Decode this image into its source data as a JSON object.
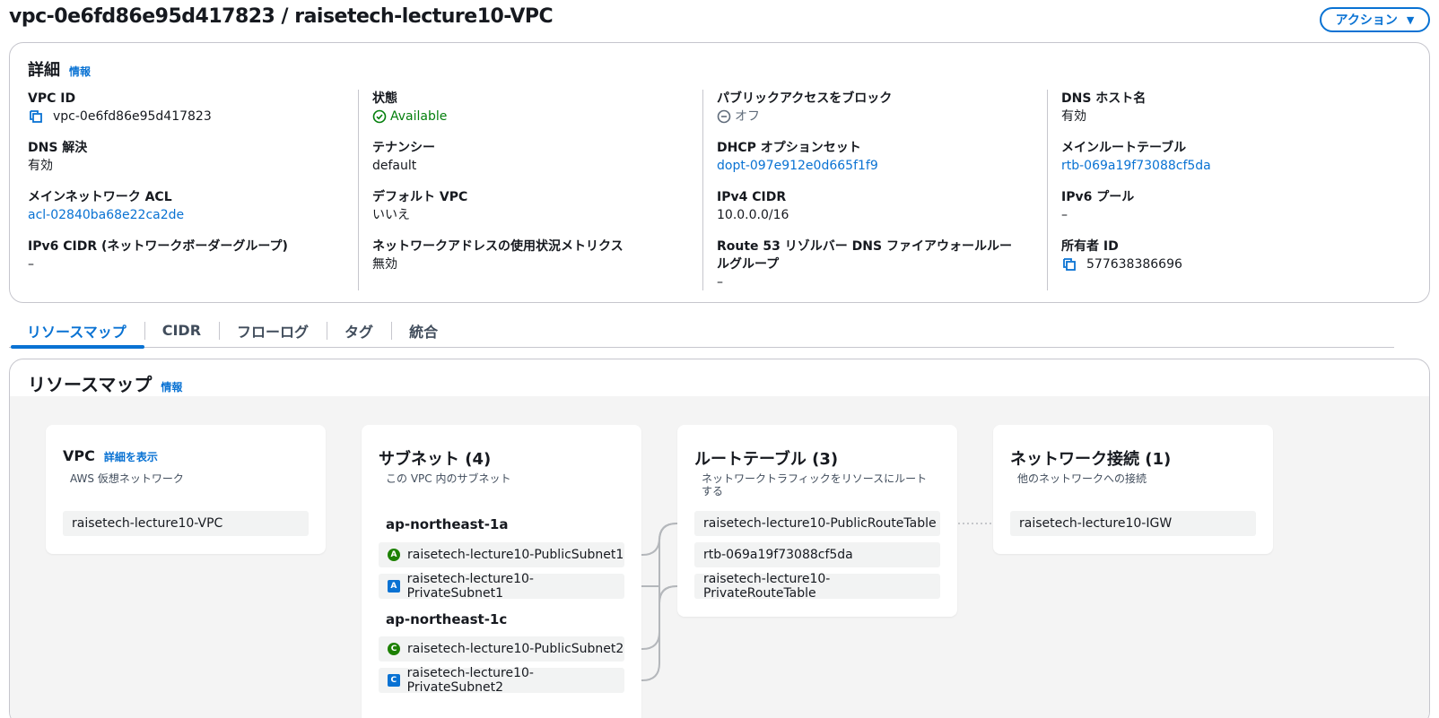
{
  "header": {
    "title": "vpc-0e6fd86e95d417823 / raisetech-lecture10-VPC",
    "actions_label": "アクション",
    "actions_caret": "▼"
  },
  "details": {
    "title": "詳細",
    "info_link": "情報",
    "columns": [
      {
        "fields": [
          {
            "label": "VPC ID",
            "value": "vpc-0e6fd86e95d417823"
          },
          {
            "label": "DNS 解決",
            "value": "有効"
          },
          {
            "label": "メインネットワーク ACL",
            "value": "acl-02840ba68e22ca2de"
          },
          {
            "label": "IPv6 CIDR (ネットワークボーダーグループ)",
            "value": "–"
          }
        ]
      },
      {
        "fields": [
          {
            "label": "状態",
            "value": "Available"
          },
          {
            "label": "テナンシー",
            "value": "default"
          },
          {
            "label": "デフォルト VPC",
            "value": "いいえ"
          },
          {
            "label": "ネットワークアドレスの使用状況メトリクス",
            "value": "無効"
          }
        ]
      },
      {
        "fields": [
          {
            "label": "パブリックアクセスをブロック",
            "value": "オフ"
          },
          {
            "label": "DHCP オプションセット",
            "value": "dopt-097e912e0d665f1f9"
          },
          {
            "label": "IPv4 CIDR",
            "value": "10.0.0.0/16"
          },
          {
            "label": "Route 53 リゾルバー DNS ファイアウォールルールグループ",
            "value": "–"
          }
        ]
      },
      {
        "fields": [
          {
            "label": "DNS ホスト名",
            "value": "有効"
          },
          {
            "label": "メインルートテーブル",
            "value": "rtb-069a19f73088cf5da"
          },
          {
            "label": "IPv6 プール",
            "value": "–"
          },
          {
            "label": "所有者 ID",
            "value": "577638386696"
          }
        ]
      }
    ]
  },
  "tabs": [
    {
      "label": "リソースマップ",
      "active": true
    },
    {
      "label": "CIDR",
      "active": false
    },
    {
      "label": "フローログ",
      "active": false
    },
    {
      "label": "タグ",
      "active": false
    },
    {
      "label": "統合",
      "active": false
    }
  ],
  "resource_map": {
    "title": "リソースマップ",
    "info_link": "情報",
    "vpc": {
      "title": "VPC",
      "detail_link": "詳細を表示",
      "description": "AWS 仮想ネットワーク",
      "item": "raisetech-lecture10-VPC"
    },
    "subnets": {
      "title": "サブネット (4)",
      "description": "この VPC 内のサブネット",
      "groups": [
        {
          "az": "ap-northeast-1a",
          "items": [
            {
              "badge": "A",
              "type": "public",
              "name": "raisetech-lecture10-PublicSubnet1"
            },
            {
              "badge": "A",
              "type": "private",
              "name": "raisetech-lecture10-PrivateSubnet1"
            }
          ]
        },
        {
          "az": "ap-northeast-1c",
          "items": [
            {
              "badge": "C",
              "type": "public",
              "name": "raisetech-lecture10-PublicSubnet2"
            },
            {
              "badge": "C",
              "type": "private",
              "name": "raisetech-lecture10-PrivateSubnet2"
            }
          ]
        }
      ]
    },
    "route_tables": {
      "title": "ルートテーブル (3)",
      "description": "ネットワークトラフィックをリソースにルートする",
      "items": [
        "raisetech-lecture10-PublicRouteTable",
        "rtb-069a19f73088cf5da",
        "raisetech-lecture10-PrivateRouteTable"
      ]
    },
    "network_connections": {
      "title": "ネットワーク接続 (1)",
      "description": "他のネットワークへの接続",
      "items": [
        "raisetech-lecture10-IGW"
      ]
    }
  },
  "colors": {
    "accent": "#0972d3",
    "success": "#037f0c",
    "public_badge": "#1d8102",
    "private_badge": "#0972d3"
  }
}
